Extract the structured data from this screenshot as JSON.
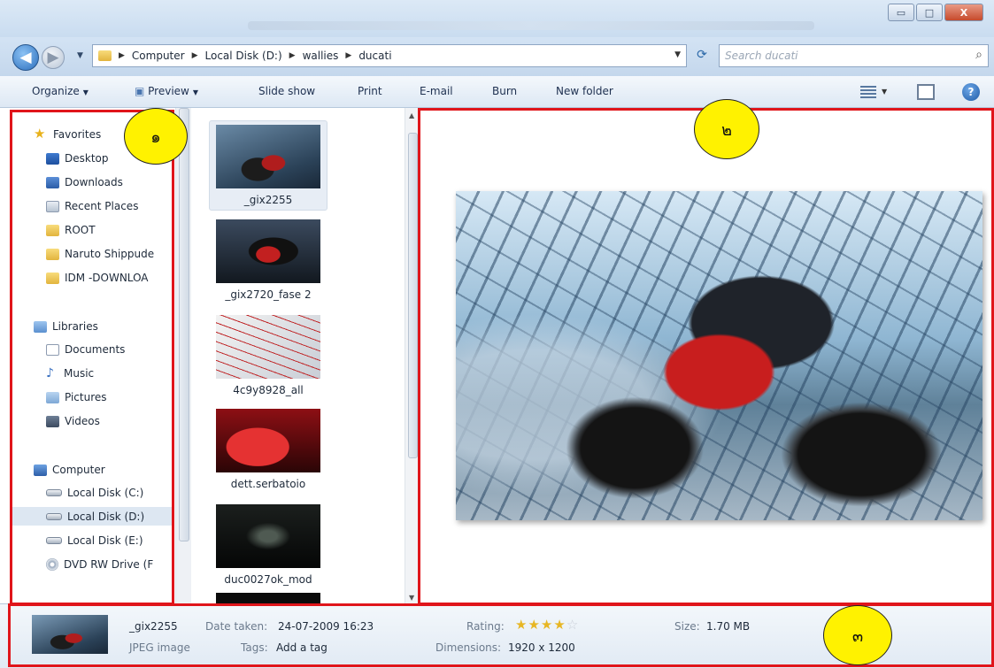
{
  "window": {
    "minimize_glyph": "▭",
    "maximize_glyph": "□",
    "close_glyph": "X"
  },
  "address": {
    "crumbs": [
      "Computer",
      "Local Disk (D:)",
      "wallies",
      "ducati"
    ],
    "search_placeholder": "Search ducati"
  },
  "toolbar": {
    "organize": "Organize",
    "preview": "Preview",
    "slideshow": "Slide show",
    "print": "Print",
    "email": "E-mail",
    "burn": "Burn",
    "new_folder": "New folder"
  },
  "navigation": {
    "favorites": {
      "label": "Favorites",
      "items": [
        "Desktop",
        "Downloads",
        "Recent Places",
        "ROOT",
        "Naruto Shippude",
        "IDM -DOWNLOA"
      ]
    },
    "libraries": {
      "label": "Libraries",
      "items": [
        "Documents",
        "Music",
        "Pictures",
        "Videos"
      ]
    },
    "computer": {
      "label": "Computer",
      "items": [
        "Local Disk (C:)",
        "Local Disk (D:)",
        "Local Disk (E:)",
        "DVD RW Drive (F"
      ]
    }
  },
  "files": [
    {
      "name": "_gix2255"
    },
    {
      "name": "_gix2720_fase 2"
    },
    {
      "name": "4c9y8928_all"
    },
    {
      "name": "dett.serbatoio"
    },
    {
      "name": "duc0027ok_mod"
    }
  ],
  "details": {
    "name": "_gix2255",
    "type": "JPEG image",
    "date_taken_label": "Date taken:",
    "date_taken": "24-07-2009 16:23",
    "tags_label": "Tags:",
    "tags": "Add a tag",
    "rating_label": "Rating:",
    "rating": 4,
    "rating_max": 5,
    "dimensions_label": "Dimensions:",
    "dimensions": "1920 x 1200",
    "size_label": "Size:",
    "size": "1.70 MB"
  },
  "callouts": [
    "๑",
    "๒",
    "๓"
  ],
  "colors": {
    "highlight_red": "#e0151b",
    "callout_yellow": "#fff200",
    "star_gold": "#e7b624"
  }
}
